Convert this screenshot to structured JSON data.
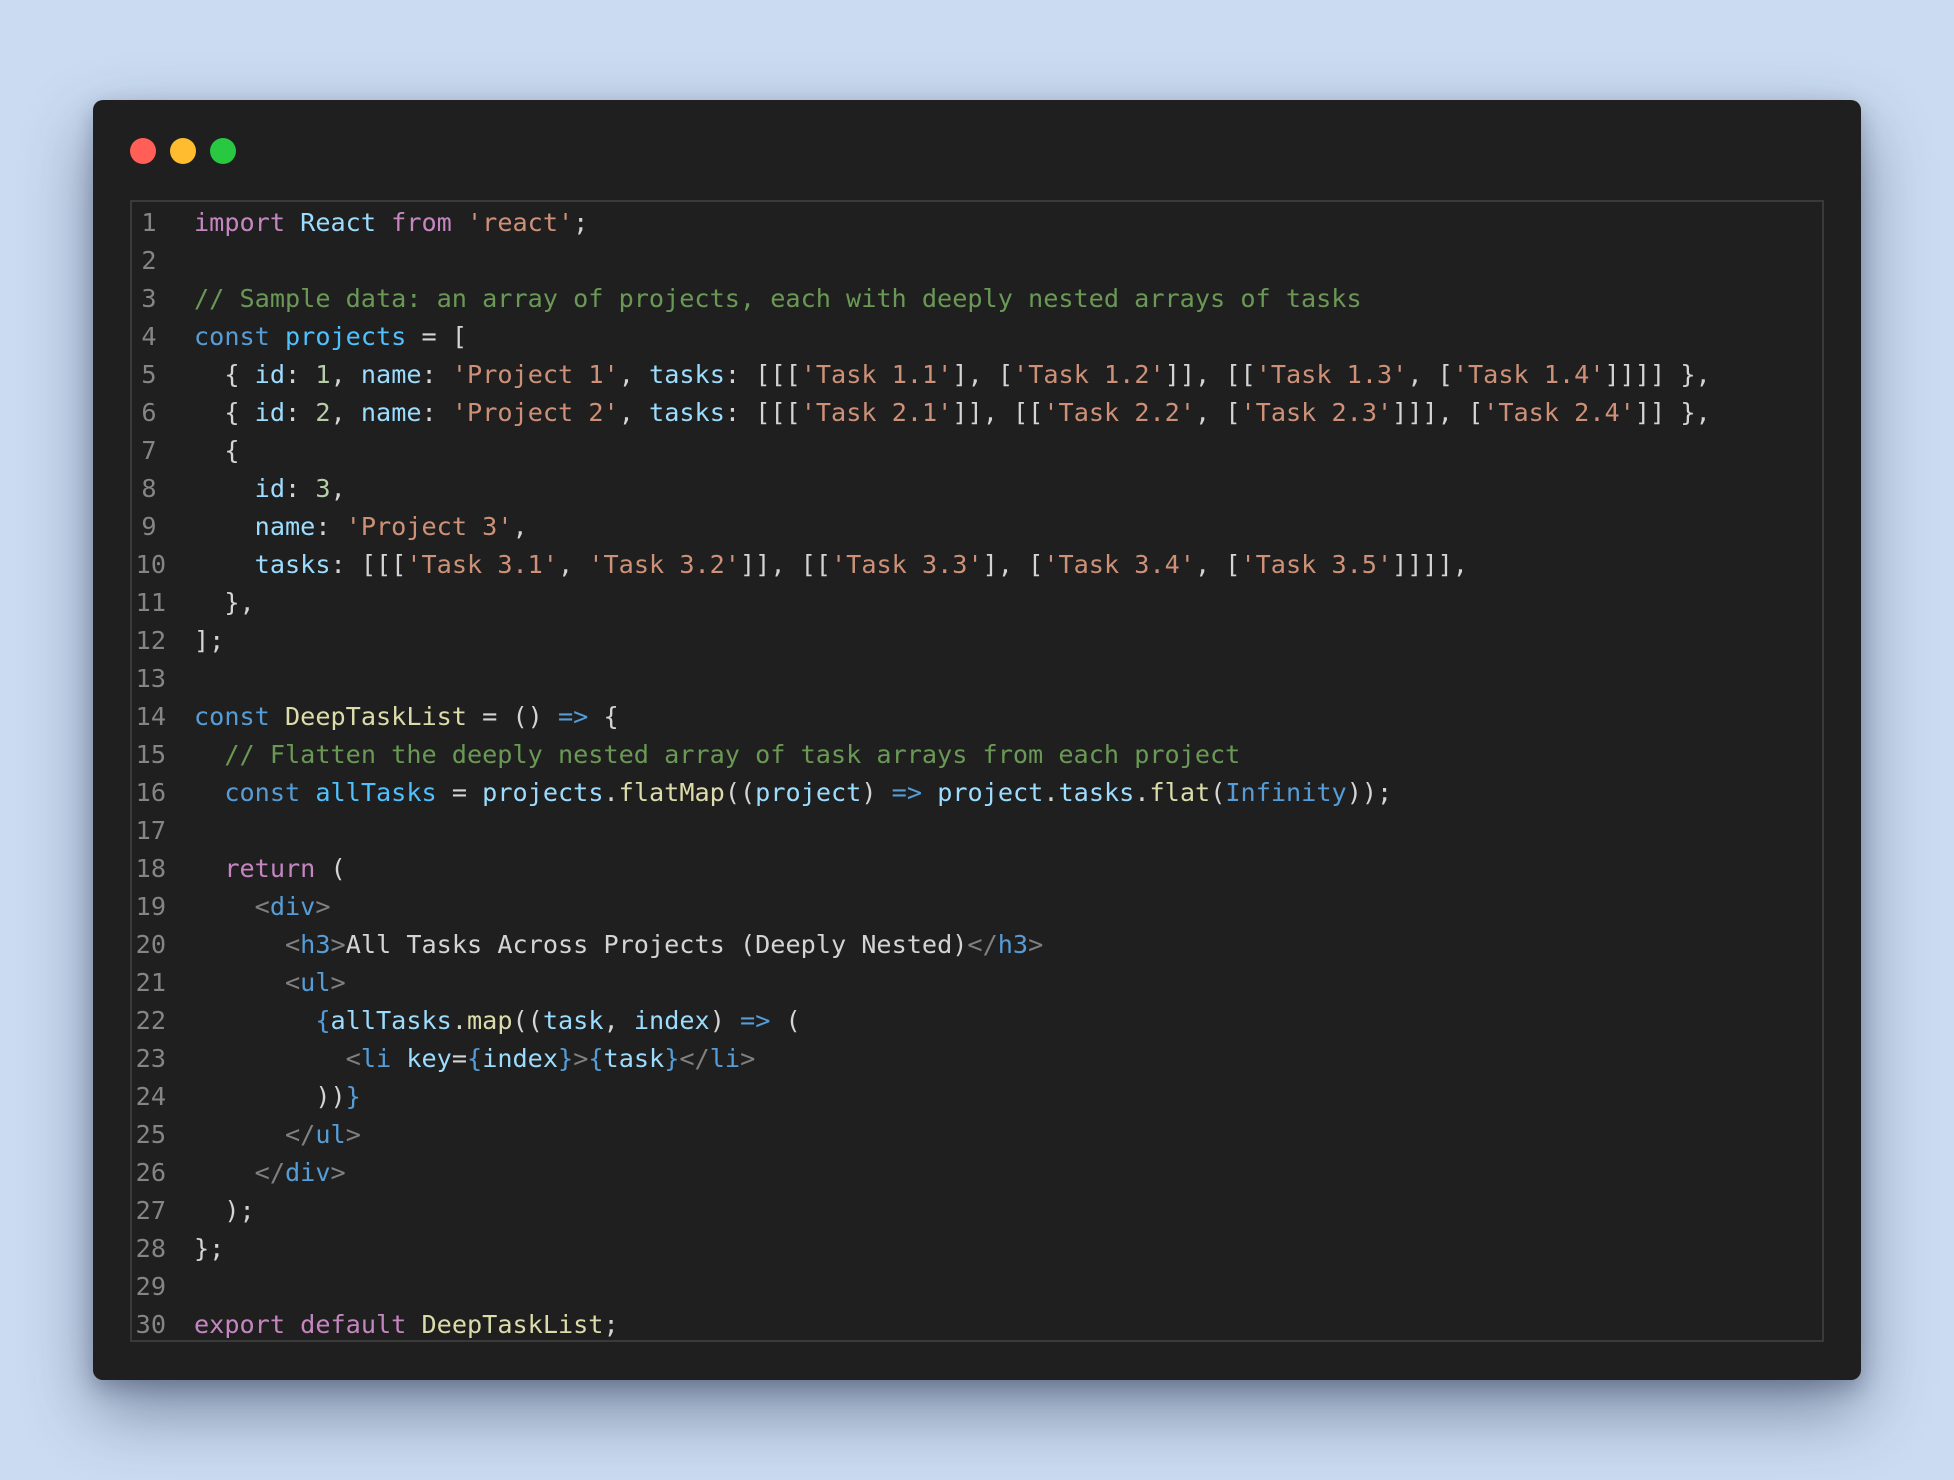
{
  "window": {
    "controls": [
      {
        "name": "close",
        "color": "#ff5f57"
      },
      {
        "name": "minimize",
        "color": "#febc2e"
      },
      {
        "name": "maximize",
        "color": "#28c840"
      }
    ]
  },
  "editor": {
    "language": "javascript-jsx",
    "lines": [
      {
        "n": "1",
        "tokens": [
          [
            "ctl",
            "import"
          ],
          [
            "p",
            " "
          ],
          [
            "var",
            "React"
          ],
          [
            "p",
            " "
          ],
          [
            "ctl",
            "from"
          ],
          [
            "p",
            " "
          ],
          [
            "str",
            "'react'"
          ],
          [
            "p",
            ";"
          ]
        ]
      },
      {
        "n": "2",
        "tokens": []
      },
      {
        "n": "3",
        "tokens": [
          [
            "com",
            "// Sample data: an array of projects, each with deeply nested arrays of tasks"
          ]
        ]
      },
      {
        "n": "4",
        "tokens": [
          [
            "kw",
            "const"
          ],
          [
            "p",
            " "
          ],
          [
            "vardecl",
            "projects"
          ],
          [
            "p",
            " = ["
          ]
        ]
      },
      {
        "n": "5",
        "tokens": [
          [
            "p",
            "  { "
          ],
          [
            "var",
            "id"
          ],
          [
            "p",
            ": "
          ],
          [
            "num",
            "1"
          ],
          [
            "p",
            ", "
          ],
          [
            "var",
            "name"
          ],
          [
            "p",
            ": "
          ],
          [
            "str",
            "'Project 1'"
          ],
          [
            "p",
            ", "
          ],
          [
            "var",
            "tasks"
          ],
          [
            "p",
            ": [[["
          ],
          [
            "str",
            "'Task 1.1'"
          ],
          [
            "p",
            "], ["
          ],
          [
            "str",
            "'Task 1.2'"
          ],
          [
            "p",
            "]], [["
          ],
          [
            "str",
            "'Task 1.3'"
          ],
          [
            "p",
            ", ["
          ],
          [
            "str",
            "'Task 1.4'"
          ],
          [
            "p",
            "]]]] },"
          ]
        ]
      },
      {
        "n": "6",
        "tokens": [
          [
            "p",
            "  { "
          ],
          [
            "var",
            "id"
          ],
          [
            "p",
            ": "
          ],
          [
            "num",
            "2"
          ],
          [
            "p",
            ", "
          ],
          [
            "var",
            "name"
          ],
          [
            "p",
            ": "
          ],
          [
            "str",
            "'Project 2'"
          ],
          [
            "p",
            ", "
          ],
          [
            "var",
            "tasks"
          ],
          [
            "p",
            ": [[["
          ],
          [
            "str",
            "'Task 2.1'"
          ],
          [
            "p",
            "]], [["
          ],
          [
            "str",
            "'Task 2.2'"
          ],
          [
            "p",
            ", ["
          ],
          [
            "str",
            "'Task 2.3'"
          ],
          [
            "p",
            "]]], ["
          ],
          [
            "str",
            "'Task 2.4'"
          ],
          [
            "p",
            "]] },"
          ]
        ]
      },
      {
        "n": "7",
        "tokens": [
          [
            "p",
            "  {"
          ]
        ]
      },
      {
        "n": "8",
        "tokens": [
          [
            "p",
            "    "
          ],
          [
            "var",
            "id"
          ],
          [
            "p",
            ": "
          ],
          [
            "num",
            "3"
          ],
          [
            "p",
            ","
          ]
        ]
      },
      {
        "n": "9",
        "tokens": [
          [
            "p",
            "    "
          ],
          [
            "var",
            "name"
          ],
          [
            "p",
            ": "
          ],
          [
            "str",
            "'Project 3'"
          ],
          [
            "p",
            ","
          ]
        ]
      },
      {
        "n": "10",
        "tokens": [
          [
            "p",
            "    "
          ],
          [
            "var",
            "tasks"
          ],
          [
            "p",
            ": [[["
          ],
          [
            "str",
            "'Task 3.1'"
          ],
          [
            "p",
            ", "
          ],
          [
            "str",
            "'Task 3.2'"
          ],
          [
            "p",
            "]], [["
          ],
          [
            "str",
            "'Task 3.3'"
          ],
          [
            "p",
            "], ["
          ],
          [
            "str",
            "'Task 3.4'"
          ],
          [
            "p",
            ", ["
          ],
          [
            "str",
            "'Task 3.5'"
          ],
          [
            "p",
            "]]]],"
          ]
        ]
      },
      {
        "n": "11",
        "tokens": [
          [
            "p",
            "  },"
          ]
        ]
      },
      {
        "n": "12",
        "tokens": [
          [
            "p",
            "];"
          ]
        ]
      },
      {
        "n": "13",
        "tokens": []
      },
      {
        "n": "14",
        "tokens": [
          [
            "kw",
            "const"
          ],
          [
            "p",
            " "
          ],
          [
            "fn",
            "DeepTaskList"
          ],
          [
            "p",
            " = () "
          ],
          [
            "kw",
            "=>"
          ],
          [
            "p",
            " {"
          ]
        ]
      },
      {
        "n": "15",
        "tokens": [
          [
            "p",
            "  "
          ],
          [
            "com",
            "// Flatten the deeply nested array of task arrays from each project"
          ]
        ]
      },
      {
        "n": "16",
        "tokens": [
          [
            "p",
            "  "
          ],
          [
            "kw",
            "const"
          ],
          [
            "p",
            " "
          ],
          [
            "vardecl",
            "allTasks"
          ],
          [
            "p",
            " = "
          ],
          [
            "var",
            "projects"
          ],
          [
            "p",
            "."
          ],
          [
            "fn",
            "flatMap"
          ],
          [
            "p",
            "(("
          ],
          [
            "var",
            "project"
          ],
          [
            "p",
            ") "
          ],
          [
            "kw",
            "=>"
          ],
          [
            "p",
            " "
          ],
          [
            "var",
            "project"
          ],
          [
            "p",
            "."
          ],
          [
            "var",
            "tasks"
          ],
          [
            "p",
            "."
          ],
          [
            "fn",
            "flat"
          ],
          [
            "p",
            "("
          ],
          [
            "kw",
            "Infinity"
          ],
          [
            "p",
            "));"
          ]
        ]
      },
      {
        "n": "17",
        "tokens": []
      },
      {
        "n": "18",
        "tokens": [
          [
            "p",
            "  "
          ],
          [
            "ctl",
            "return"
          ],
          [
            "p",
            " ("
          ]
        ]
      },
      {
        "n": "19",
        "tokens": [
          [
            "p",
            "    "
          ],
          [
            "ang",
            "<"
          ],
          [
            "tag",
            "div"
          ],
          [
            "ang",
            ">"
          ]
        ]
      },
      {
        "n": "20",
        "tokens": [
          [
            "p",
            "      "
          ],
          [
            "ang",
            "<"
          ],
          [
            "tag",
            "h3"
          ],
          [
            "ang",
            ">"
          ],
          [
            "txt",
            "All Tasks Across Projects (Deeply Nested)"
          ],
          [
            "ang",
            "</"
          ],
          [
            "tag",
            "h3"
          ],
          [
            "ang",
            ">"
          ]
        ]
      },
      {
        "n": "21",
        "tokens": [
          [
            "p",
            "      "
          ],
          [
            "ang",
            "<"
          ],
          [
            "tag",
            "ul"
          ],
          [
            "ang",
            ">"
          ]
        ]
      },
      {
        "n": "22",
        "tokens": [
          [
            "p",
            "        "
          ],
          [
            "kw",
            "{"
          ],
          [
            "var",
            "allTasks"
          ],
          [
            "p",
            "."
          ],
          [
            "fn",
            "map"
          ],
          [
            "p",
            "(("
          ],
          [
            "var",
            "task"
          ],
          [
            "p",
            ", "
          ],
          [
            "var",
            "index"
          ],
          [
            "p",
            ") "
          ],
          [
            "kw",
            "=>"
          ],
          [
            "p",
            " ("
          ]
        ]
      },
      {
        "n": "23",
        "tokens": [
          [
            "p",
            "          "
          ],
          [
            "ang",
            "<"
          ],
          [
            "tag",
            "li"
          ],
          [
            "p",
            " "
          ],
          [
            "var",
            "key"
          ],
          [
            "p",
            "="
          ],
          [
            "kw",
            "{"
          ],
          [
            "var",
            "index"
          ],
          [
            "kw",
            "}"
          ],
          [
            "ang",
            ">"
          ],
          [
            "kw",
            "{"
          ],
          [
            "var",
            "task"
          ],
          [
            "kw",
            "}"
          ],
          [
            "ang",
            "</"
          ],
          [
            "tag",
            "li"
          ],
          [
            "ang",
            ">"
          ]
        ]
      },
      {
        "n": "24",
        "tokens": [
          [
            "p",
            "        ))"
          ],
          [
            "kw",
            "}"
          ]
        ]
      },
      {
        "n": "25",
        "tokens": [
          [
            "p",
            "      "
          ],
          [
            "ang",
            "</"
          ],
          [
            "tag",
            "ul"
          ],
          [
            "ang",
            ">"
          ]
        ]
      },
      {
        "n": "26",
        "tokens": [
          [
            "p",
            "    "
          ],
          [
            "ang",
            "</"
          ],
          [
            "tag",
            "div"
          ],
          [
            "ang",
            ">"
          ]
        ]
      },
      {
        "n": "27",
        "tokens": [
          [
            "p",
            "  );"
          ]
        ]
      },
      {
        "n": "28",
        "tokens": [
          [
            "p",
            "};"
          ]
        ]
      },
      {
        "n": "29",
        "tokens": []
      },
      {
        "n": "30",
        "tokens": [
          [
            "ctl",
            "export"
          ],
          [
            "p",
            " "
          ],
          [
            "ctl",
            "default"
          ],
          [
            "p",
            " "
          ],
          [
            "fn",
            "DeepTaskList"
          ],
          [
            "p",
            ";"
          ]
        ]
      }
    ]
  }
}
